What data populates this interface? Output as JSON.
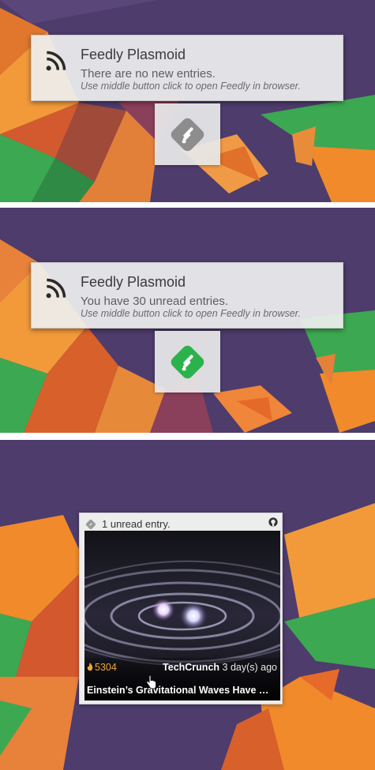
{
  "notifications": [
    {
      "title": "Feedly Plasmoid",
      "message": "There are no new entries.",
      "hint": "Use middle button click to open Feedly in browser.",
      "icon": "rss-icon"
    },
    {
      "title": "Feedly Plasmoid",
      "message": "You have 30 unread entries.",
      "hint": "Use middle button click to open Feedly in browser.",
      "icon": "rss-icon"
    }
  ],
  "tray_icons": [
    {
      "icon": "feedly-icon",
      "state": "no-new-entries",
      "color": "#8d8d8d"
    },
    {
      "icon": "feedly-icon",
      "state": "unread",
      "color": "#2bb24c"
    }
  ],
  "widget": {
    "header": {
      "logo": "feedly-icon",
      "unread_text": "1 unread entry.",
      "link_icon": "github-icon"
    },
    "entry": {
      "engagement": "5304",
      "engagement_icon": "flame-icon",
      "source": "TechCrunch",
      "age": "3 day(s) ago",
      "title": "Einstein’s Gravitational Waves Have …",
      "engagement_color": "#f0a92b"
    }
  },
  "colors": {
    "wallpaper_base": "#4e3c6c",
    "orange": "#f08a2a",
    "green": "#3ca852"
  }
}
